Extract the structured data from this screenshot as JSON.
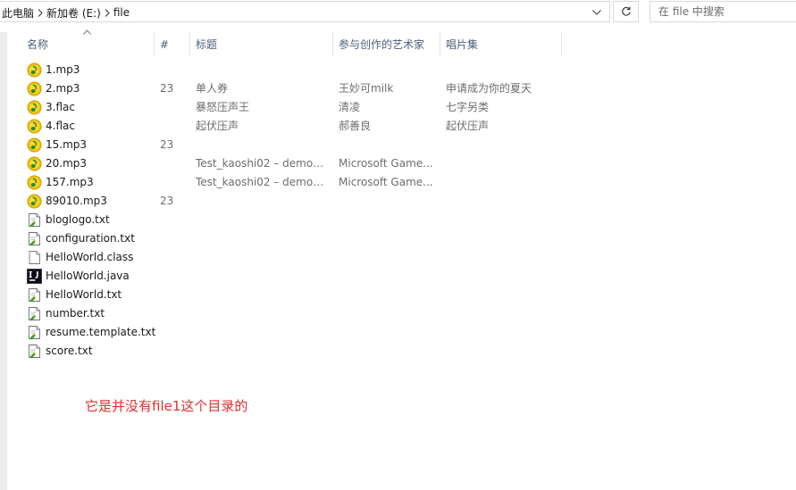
{
  "address_bar": {
    "breadcrumbs": [
      "此电脑",
      "新加卷 (E:)",
      "file"
    ]
  },
  "search": {
    "placeholder": "在 file 中搜索"
  },
  "columns": {
    "name": "名称",
    "number": "#",
    "title": "标题",
    "artist": "参与创作的艺术家",
    "album": "唱片集"
  },
  "files": [
    {
      "name": "1.mp3",
      "icon": "music-file-icon",
      "number": "",
      "title": "",
      "artist": "",
      "album": ""
    },
    {
      "name": "2.mp3",
      "icon": "music-file-icon",
      "number": "23",
      "title": "单人券",
      "artist": "王妙可milk",
      "album": "申请成为你的夏天"
    },
    {
      "name": "3.flac",
      "icon": "music-file-icon",
      "number": "",
      "title": "暴怒压声王",
      "artist": "清凌",
      "album": "七字另类"
    },
    {
      "name": "4.flac",
      "icon": "music-file-icon",
      "number": "",
      "title": "起伏压声",
      "artist": "郝善良",
      "album": "起伏压声"
    },
    {
      "name": "15.mp3",
      "icon": "music-file-icon",
      "number": "23",
      "title": "",
      "artist": "",
      "album": ""
    },
    {
      "name": "20.mp3",
      "icon": "music-file-icon",
      "number": "",
      "title": "Test_kaoshi02 – demo0...",
      "artist": "Microsoft Game...",
      "album": ""
    },
    {
      "name": "157.mp3",
      "icon": "music-file-icon",
      "number": "",
      "title": "Test_kaoshi02 – demo0...",
      "artist": "Microsoft Game...",
      "album": ""
    },
    {
      "name": "89010.mp3",
      "icon": "music-file-icon",
      "number": "23",
      "title": "",
      "artist": "",
      "album": ""
    },
    {
      "name": "bloglogo.txt",
      "icon": "text-file-icon",
      "number": "",
      "title": "",
      "artist": "",
      "album": ""
    },
    {
      "name": "configuration.txt",
      "icon": "text-file-icon",
      "number": "",
      "title": "",
      "artist": "",
      "album": ""
    },
    {
      "name": "HelloWorld.class",
      "icon": "blank-file-icon",
      "number": "",
      "title": "",
      "artist": "",
      "album": ""
    },
    {
      "name": "HelloWorld.java",
      "icon": "intellij-file-icon",
      "number": "",
      "title": "",
      "artist": "",
      "album": ""
    },
    {
      "name": "HelloWorld.txt",
      "icon": "text-file-icon",
      "number": "",
      "title": "",
      "artist": "",
      "album": ""
    },
    {
      "name": "number.txt",
      "icon": "text-file-icon",
      "number": "",
      "title": "",
      "artist": "",
      "album": ""
    },
    {
      "name": "resume.template.txt",
      "icon": "text-file-icon",
      "number": "",
      "title": "",
      "artist": "",
      "album": ""
    },
    {
      "name": "score.txt",
      "icon": "text-file-icon",
      "number": "",
      "title": "",
      "artist": "",
      "album": ""
    }
  ],
  "annotation": {
    "text": "它是并没有file1这个目录的",
    "color": "#e03030"
  },
  "colors": {
    "header_text": "#4c607a",
    "border": "#d9d9d9",
    "annotation": "#e03030"
  }
}
